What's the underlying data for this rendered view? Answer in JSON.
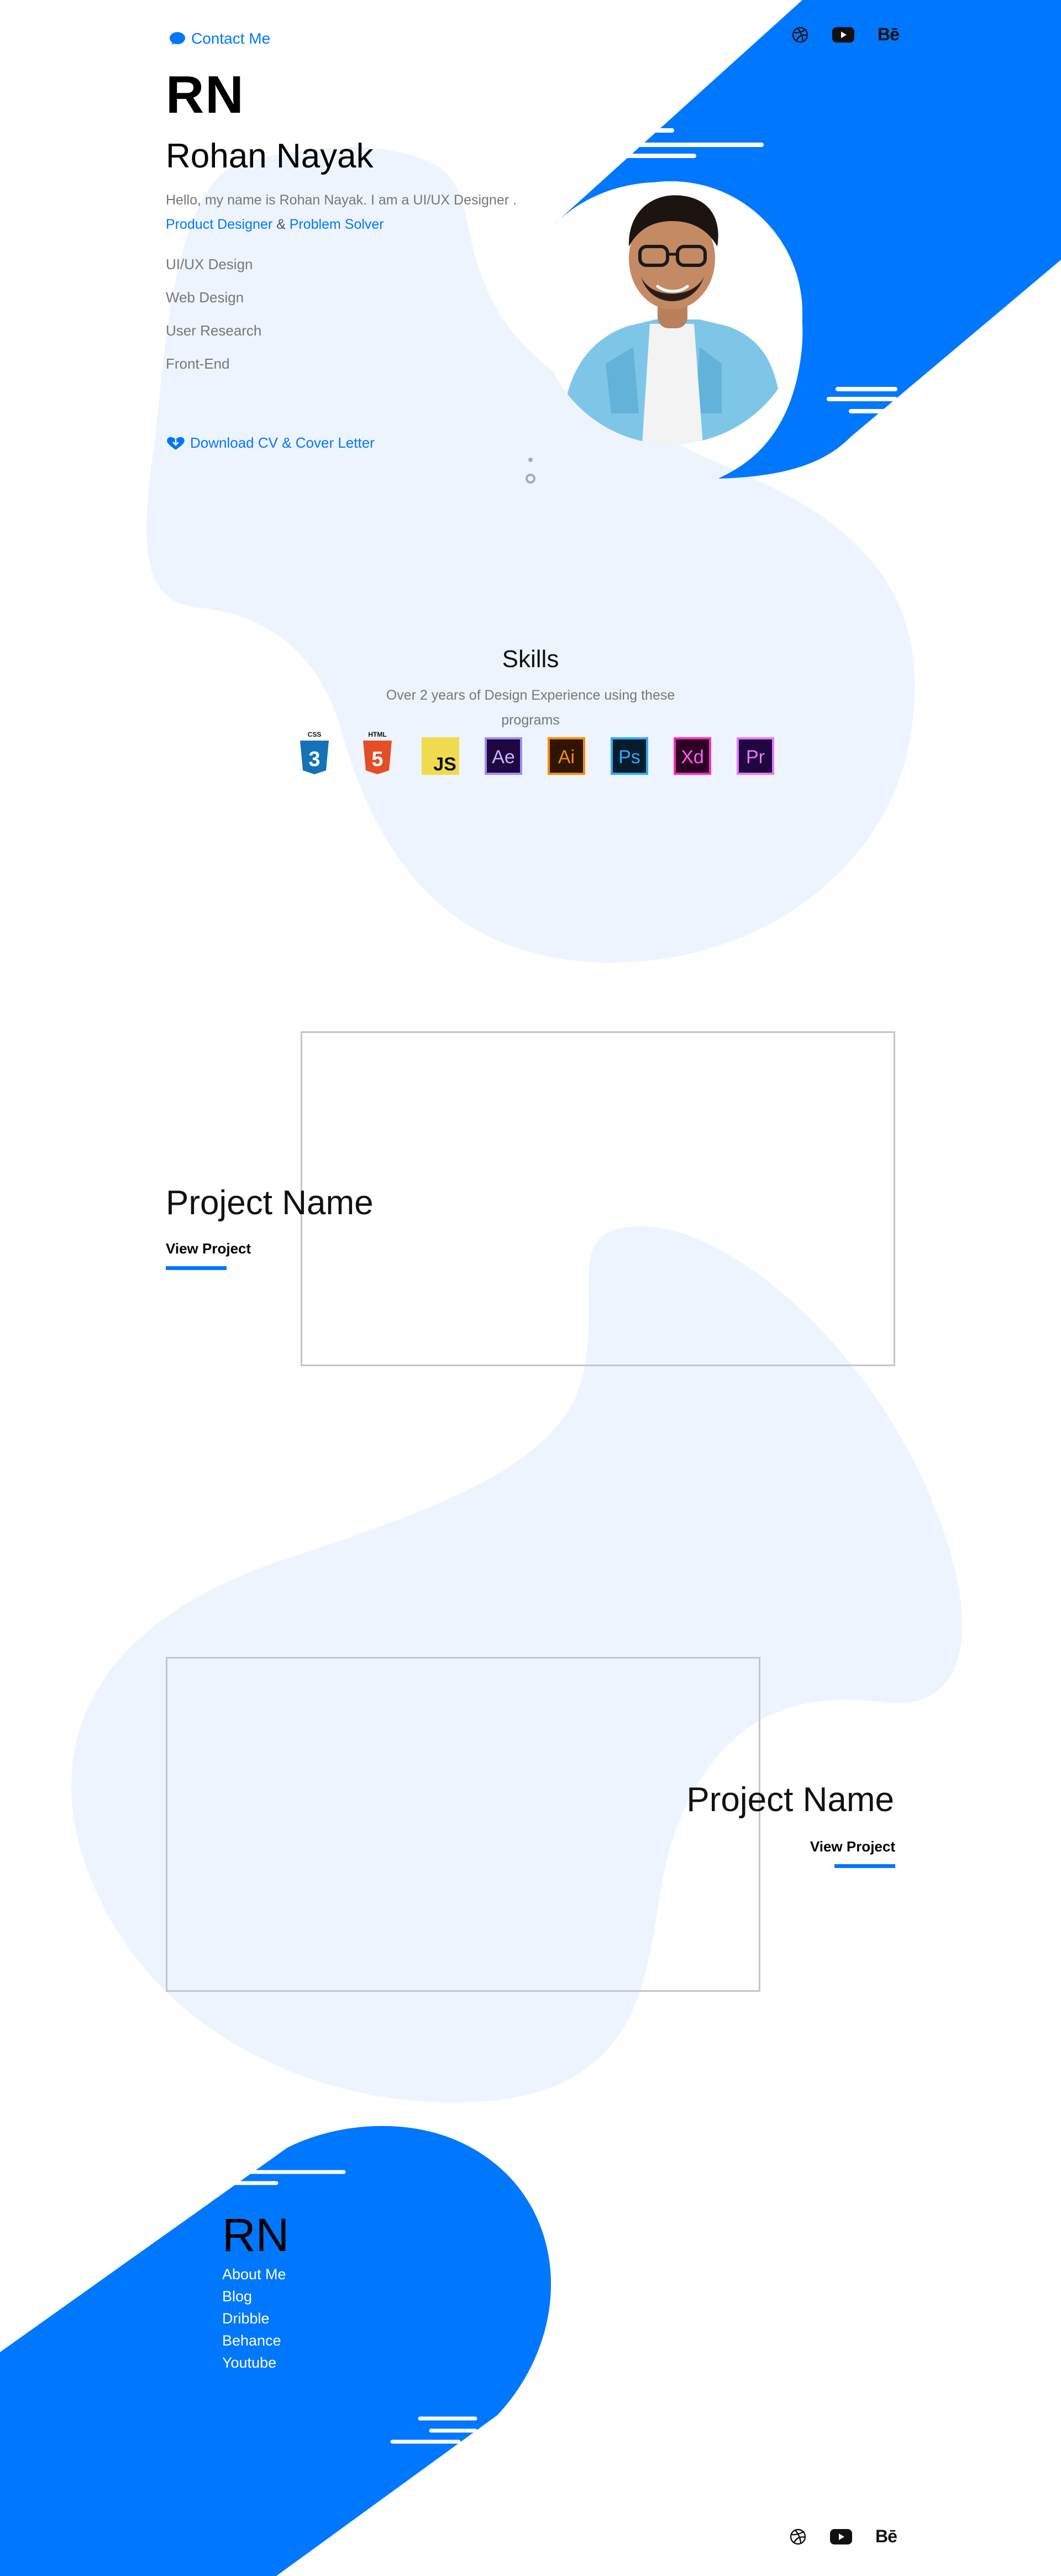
{
  "header": {
    "contact_label": "Contact Me",
    "social": [
      "dribbble-icon",
      "youtube-icon",
      "behance-icon"
    ],
    "behance_glyph": "Bē"
  },
  "hero": {
    "logo": "RN",
    "name": "Rohan Nayak",
    "intro_line1": "Hello, my name is Rohan Nayak. I am a UI/UX Designer .",
    "role1": "Product Designer",
    "amp": " & ",
    "role2": "Problem Solver",
    "services": [
      "UI/UX Design",
      "Web Design",
      "User Research",
      "Front-End"
    ],
    "download_label": "Download CV & Cover Letter"
  },
  "skills": {
    "title": "Skills",
    "description": "Over 2 years of Design Experience using these programs",
    "items": [
      {
        "icon": "css3-icon",
        "badge": "CSS",
        "glyph": "3"
      },
      {
        "icon": "html5-icon",
        "badge": "HTML",
        "glyph": "5"
      },
      {
        "icon": "javascript-icon",
        "glyph": "JS"
      },
      {
        "icon": "after-effects-icon",
        "glyph": "Ae"
      },
      {
        "icon": "illustrator-icon",
        "glyph": "Ai"
      },
      {
        "icon": "photoshop-icon",
        "glyph": "Ps"
      },
      {
        "icon": "xd-icon",
        "glyph": "Xd"
      },
      {
        "icon": "premiere-icon",
        "glyph": "Pr"
      }
    ]
  },
  "projects": [
    {
      "title": "Project Name",
      "link_label": "View Project"
    },
    {
      "title": "Project Name",
      "link_label": "View Project"
    }
  ],
  "footer": {
    "logo": "RN",
    "links": [
      "About Me",
      "Blog",
      "Dribble",
      "Behance",
      "Youtube"
    ]
  },
  "colors": {
    "accent": "#0077ff",
    "blob": "#eef4fe",
    "muted_text": "#777777"
  }
}
